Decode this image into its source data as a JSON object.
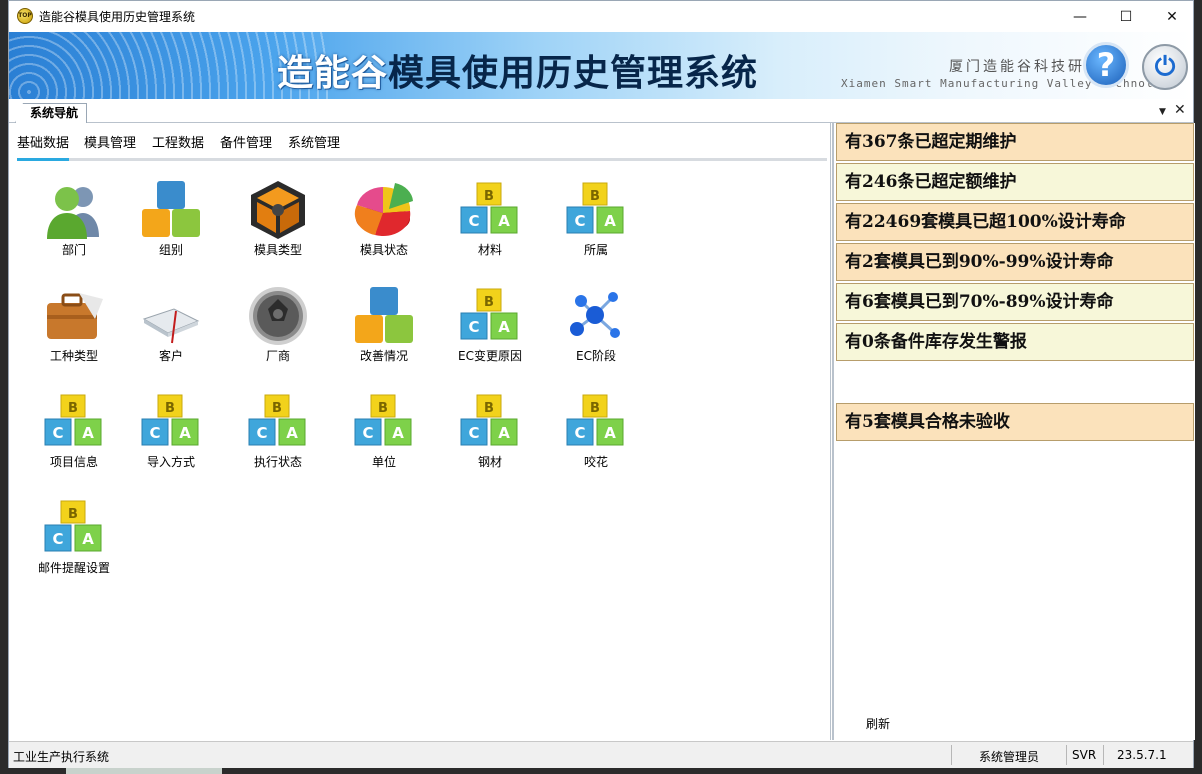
{
  "window": {
    "title": "造能谷模具使用历史管理系统",
    "app_icon_text": "TOP",
    "controls": {
      "minimize": "—",
      "maximize": "☐",
      "close": "✕"
    }
  },
  "banner": {
    "brand": "造能谷",
    "title_rest": "模具使用历史管理系统",
    "company_cn": "厦门造能谷科技研",
    "company_en": "Xiamen Smart Manufacturing Valley Technolog"
  },
  "nav": {
    "tab_label": "系统导航",
    "subtabs": [
      "基础数据",
      "模具管理",
      "工程数据",
      "备件管理",
      "系统管理"
    ],
    "active_subtab": "基础数据",
    "items": [
      {
        "label": "部门",
        "icon": "people-icon"
      },
      {
        "label": "组别",
        "icon": "blocks-icon"
      },
      {
        "label": "模具类型",
        "icon": "gear-box-icon"
      },
      {
        "label": "模具状态",
        "icon": "pie-icon"
      },
      {
        "label": "材料",
        "icon": "abc-blocks-icon"
      },
      {
        "label": "所属",
        "icon": "abc-blocks-icon"
      },
      {
        "label": "工种类型",
        "icon": "briefcase-icon"
      },
      {
        "label": "客户",
        "icon": "book-icon"
      },
      {
        "label": "厂商",
        "icon": "aperture-icon"
      },
      {
        "label": "改善情况",
        "icon": "blocks-icon"
      },
      {
        "label": "EC变更原因",
        "icon": "abc-blocks-icon"
      },
      {
        "label": "EC阶段",
        "icon": "molecule-icon"
      },
      {
        "label": "项目信息",
        "icon": "abc-blocks-icon"
      },
      {
        "label": "导入方式",
        "icon": "abc-blocks-icon"
      },
      {
        "label": "执行状态",
        "icon": "abc-blocks-icon"
      },
      {
        "label": "单位",
        "icon": "abc-blocks-icon"
      },
      {
        "label": "钢材",
        "icon": "abc-blocks-icon"
      },
      {
        "label": "咬花",
        "icon": "abc-blocks-icon"
      },
      {
        "label": "邮件提醒设置",
        "icon": "abc-blocks-icon"
      }
    ]
  },
  "alerts": {
    "items": [
      {
        "text": "有367条已超定期维护",
        "style": "orange"
      },
      {
        "text": "有246条已超定额维护",
        "style": "cream"
      },
      {
        "text": "有22469套模具已超100%设计寿命",
        "style": "orange"
      },
      {
        "text": "有2套模具已到90%-99%设计寿命",
        "style": "orange"
      },
      {
        "text": "有6套模具已到70%-89%设计寿命",
        "style": "cream"
      },
      {
        "text": "有0条备件库存发生警报",
        "style": "cream"
      },
      {
        "text": "有5套模具合格未验收",
        "style": "orange"
      }
    ],
    "refresh_label": "刷新"
  },
  "statusbar": {
    "left": "工业生产执行系统",
    "user": "系统管理员",
    "server": "SVR",
    "version": "23.5.7.1"
  },
  "colors": {
    "alert_orange": "#fbe2bb",
    "alert_cream": "#f7f7d9",
    "active_tab_underline": "#2aa9e0"
  }
}
